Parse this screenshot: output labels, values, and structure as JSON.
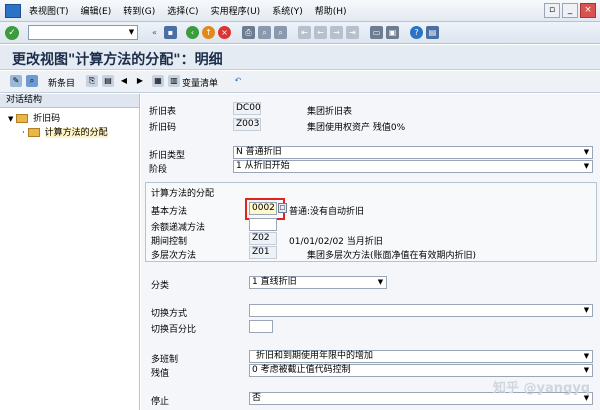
{
  "menu": [
    "表视图(T)",
    "编辑(E)",
    "转到(G)",
    "选择(C)",
    "实用程序(U)",
    "系统(Y)",
    "帮助(H)"
  ],
  "title": "更改视图\"计算方法的分配\"：明细",
  "app_toolbar": {
    "new_entries": "新条目",
    "change_list": "变量清单"
  },
  "dialog_structure": {
    "header": "对话结构",
    "items": [
      "折旧码",
      "计算方法的分配"
    ]
  },
  "header_fields": {
    "depreciation_table_label": "折旧表",
    "depreciation_table_value": "DC00",
    "depreciation_table_desc": "集团折旧表",
    "depreciation_key_label": "折旧码",
    "depreciation_key_value": "Z003",
    "depreciation_key_desc": "集团使用权资产 残值0%"
  },
  "type_fields": {
    "dep_type_label": "折旧类型",
    "dep_type_value": "N 普通折旧",
    "phase_label": "阶段",
    "phase_value": "1 从折旧开始"
  },
  "method_group": {
    "title": "计算方法的分配",
    "base_method_label": "基本方法",
    "base_method_value": "0002",
    "base_method_desc": "普通:没有自动折旧",
    "declining_label": "余额递减方法",
    "period_control_label": "期间控制",
    "period_control_value": "Z02",
    "period_control_desc": "01/01/02/02 当月折旧",
    "multilevel_label": "多层次方法",
    "multilevel_value": "Z01",
    "multilevel_desc": "集团多层次方法(账面净值在有效期内折旧)"
  },
  "class_fields": {
    "class_label": "分类",
    "class_value": "1 直线折旧",
    "switch_method_label": "切换方式",
    "switch_percent_label": "切换百分比",
    "multishift_label": "多班制",
    "multishift_value": "折旧和到期使用年限中的增加",
    "residual_label": "残值",
    "residual_value": "0 考虑被截止值代码控制",
    "shutdown_label": "停止",
    "shutdown_value": "否"
  },
  "watermark": "知乎 @yangyq"
}
